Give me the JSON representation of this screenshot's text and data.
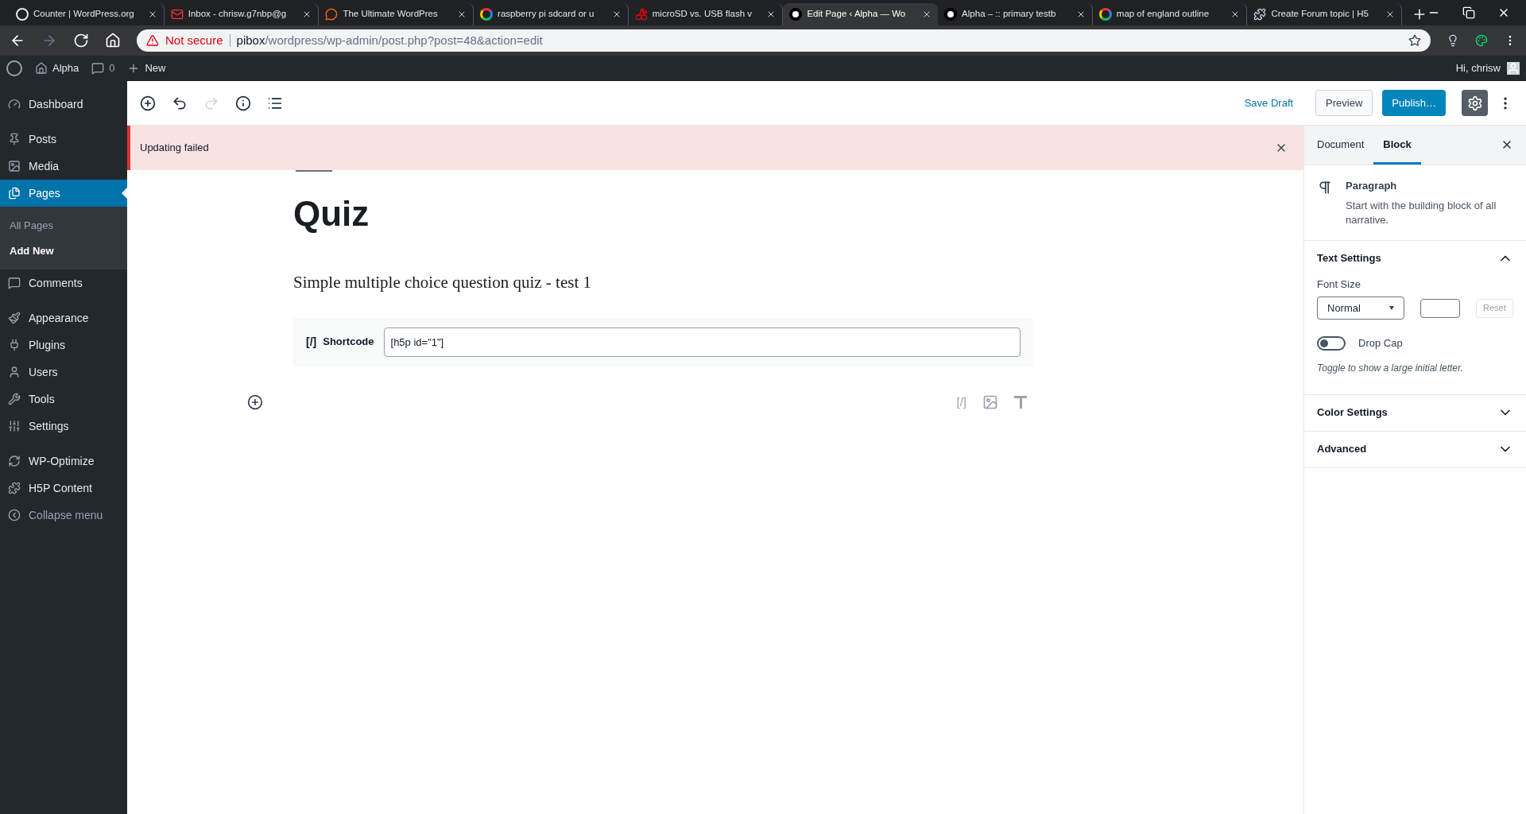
{
  "browser": {
    "tabs": [
      {
        "title": "Counter | WordPress.org",
        "selected": false
      },
      {
        "title": "Inbox - chrisw.g7nbp@g",
        "selected": false
      },
      {
        "title": "The Ultimate WordPres",
        "selected": false
      },
      {
        "title": "raspberry pi sdcard or u",
        "selected": false
      },
      {
        "title": "microSD vs. USB flash v",
        "selected": false
      },
      {
        "title": "Edit Page ‹ Alpha — Wo",
        "selected": true
      },
      {
        "title": "Alpha – :: primary testb",
        "selected": false
      },
      {
        "title": "map of england outline",
        "selected": false
      },
      {
        "title": "Create Forum topic | H5",
        "selected": false
      }
    ],
    "security": "Not secure",
    "url_host": "pibox",
    "url_path": "/wordpress/wp-admin/post.php?post=48&action=edit"
  },
  "admin_bar": {
    "site": "Alpha",
    "comments": "0",
    "new": "New",
    "greeting": "Hi, chrisw"
  },
  "sidebar": {
    "groups": [
      [
        {
          "label": "Dashboard",
          "selected": false
        }
      ],
      [
        {
          "label": "Posts",
          "selected": false
        },
        {
          "label": "Media",
          "selected": false
        },
        {
          "label": "Pages",
          "selected": true,
          "children": [
            {
              "label": "All Pages",
              "selected": false
            },
            {
              "label": "Add New",
              "selected": true
            }
          ]
        },
        {
          "label": "Comments",
          "selected": false
        }
      ],
      [
        {
          "label": "Appearance",
          "selected": false
        },
        {
          "label": "Plugins",
          "selected": false
        },
        {
          "label": "Users",
          "selected": false
        },
        {
          "label": "Tools",
          "selected": false
        },
        {
          "label": "Settings",
          "selected": false
        }
      ],
      [
        {
          "label": "WP-Optimize",
          "selected": false
        },
        {
          "label": "H5P Content",
          "selected": false
        },
        {
          "label": "Collapse menu",
          "selected": false
        }
      ]
    ]
  },
  "toolbar": {
    "save_draft": "Save Draft",
    "preview": "Preview",
    "publish": "Publish…"
  },
  "notice": {
    "text": "Updating failed"
  },
  "post": {
    "title": "Quiz",
    "paragraph": "Simple multiple choice question quiz - test 1",
    "shortcode": {
      "icon_text": "[/]",
      "label": "Shortcode",
      "value": "[h5p id=\"1\"]"
    },
    "inserter_shortcut": "[/]"
  },
  "settings": {
    "tabs": [
      {
        "label": "Document",
        "selected": false
      },
      {
        "label": "Block",
        "selected": true
      }
    ],
    "block": {
      "name": "Paragraph",
      "description": "Start with the building block of all narrative."
    },
    "panels": [
      {
        "title": "Text Settings",
        "expanded": true,
        "font_size_label": "Font Size",
        "font_size": "Normal",
        "reset": "Reset",
        "reset_disabled": true,
        "drop_cap": {
          "label": "Drop Cap",
          "on": false,
          "help": "Toggle to show a large initial letter."
        }
      },
      {
        "title": "Color Settings",
        "expanded": false
      },
      {
        "title": "Advanced",
        "expanded": false
      }
    ]
  }
}
